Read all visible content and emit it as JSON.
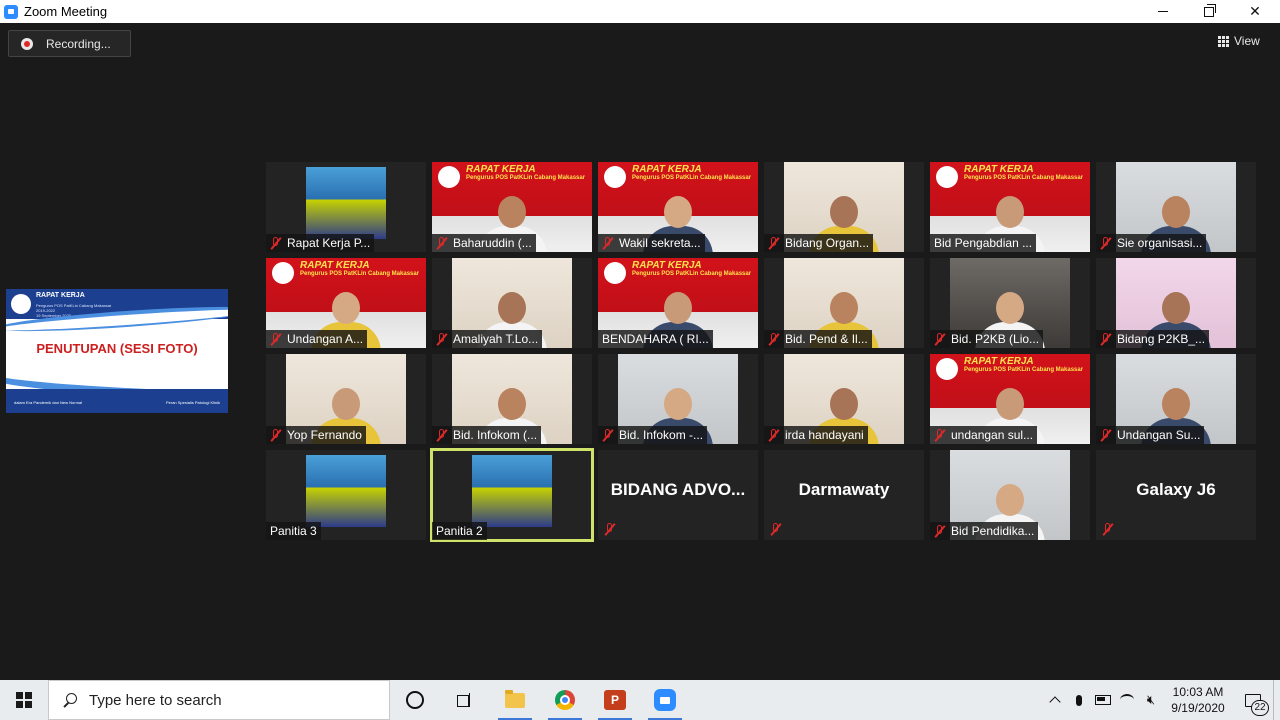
{
  "window": {
    "title": "Zoom Meeting"
  },
  "toolbar": {
    "recording_label": "Recording...",
    "view_label": "View"
  },
  "share": {
    "header": "RAPAT KERJA",
    "subheader": "Pengurus POS PatKLin Cabang Makassar",
    "subheader2": "2019-2022",
    "date": "19 September 2020",
    "main_text": "PENUTUPAN (SESI FOTO)",
    "footer_left": "dalam Era Pandemik dan New Normal",
    "footer_right": "Peran Spesialis Patologi Klinik"
  },
  "banner": {
    "title": "RAPAT KERJA",
    "subtitle": "Pengurus POS PatKLin Cabang Makassar"
  },
  "participants": [
    {
      "name": "Rapat Kerja P...",
      "bg": "poster",
      "muted": true,
      "video": true
    },
    {
      "name": "Baharuddin (...",
      "bg": "red",
      "muted": true,
      "video": true
    },
    {
      "name": "Wakil sekreta...",
      "bg": "red",
      "muted": true,
      "video": true
    },
    {
      "name": "Bidang Organ...",
      "bg": "room",
      "muted": true,
      "video": true
    },
    {
      "name": "Bid Pengabdian ...",
      "bg": "red",
      "muted": false,
      "video": true
    },
    {
      "name": "Sie organisasi...",
      "bg": "wall",
      "muted": true,
      "video": true
    },
    {
      "name": "Undangan A...",
      "bg": "red",
      "muted": true,
      "video": true
    },
    {
      "name": "Amaliyah T.Lo...",
      "bg": "room",
      "muted": true,
      "video": true
    },
    {
      "name": "BENDAHARA ( RI...",
      "bg": "red",
      "muted": false,
      "video": true
    },
    {
      "name": "Bid. Pend & Il...",
      "bg": "room",
      "muted": true,
      "video": true
    },
    {
      "name": "Bid. P2KB (Lio...",
      "bg": "dark",
      "muted": true,
      "video": true
    },
    {
      "name": "Bidang P2KB_...",
      "bg": "pink",
      "muted": true,
      "video": true
    },
    {
      "name": "Yop Fernando",
      "bg": "room",
      "muted": true,
      "video": true
    },
    {
      "name": "Bid. Infokom (...",
      "bg": "room",
      "muted": true,
      "video": true
    },
    {
      "name": "Bid. Infokom -...",
      "bg": "wall",
      "muted": true,
      "video": true
    },
    {
      "name": "irda handayani",
      "bg": "room",
      "muted": true,
      "video": true
    },
    {
      "name": "undangan sul...",
      "bg": "red",
      "muted": true,
      "video": true
    },
    {
      "name": "Undangan Su...",
      "bg": "wall",
      "muted": true,
      "video": true
    },
    {
      "name": "Panitia 3",
      "bg": "poster",
      "muted": false,
      "video": true
    },
    {
      "name": "Panitia 2",
      "bg": "poster",
      "muted": false,
      "video": true,
      "active": true
    },
    {
      "name": "BIDANG ADVO...",
      "bg": "none",
      "muted": true,
      "video": false
    },
    {
      "name": "Darmawaty",
      "bg": "none",
      "muted": true,
      "video": false
    },
    {
      "name": "Bid Pendidika...",
      "bg": "wall",
      "muted": true,
      "video": true
    },
    {
      "name": "Galaxy J6",
      "bg": "none",
      "muted": true,
      "video": false
    }
  ],
  "taskbar": {
    "search_placeholder": "Type here to search",
    "ppt_letter": "P",
    "time": "10:03 AM",
    "date": "9/19/2020",
    "notification_count": "22"
  }
}
